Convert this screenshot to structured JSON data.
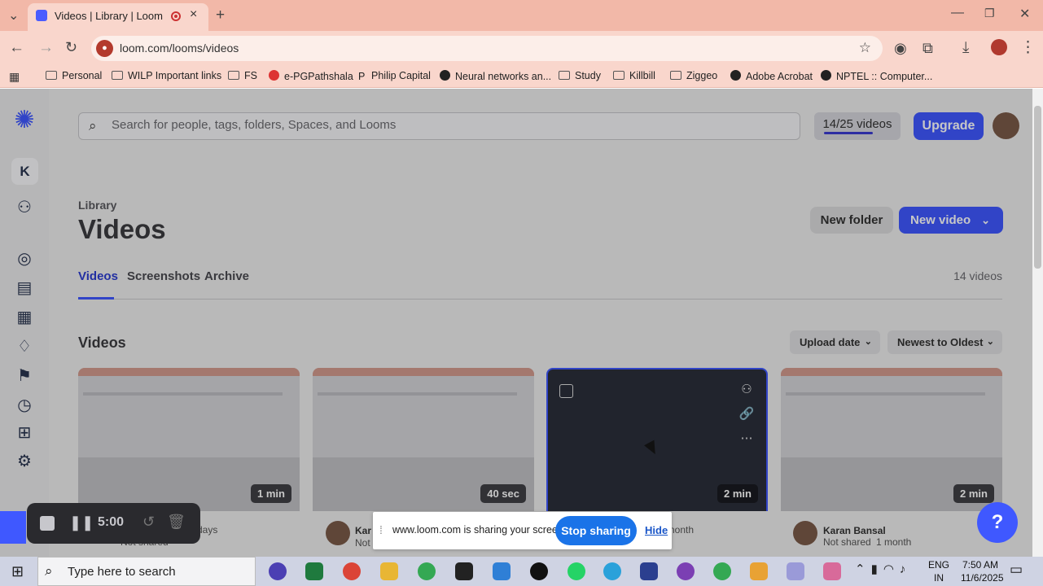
{
  "browser": {
    "tab_title": "Videos | Library | Loom",
    "url": "loom.com/looms/videos",
    "bookmarks": [
      "Personal",
      "WILP Important links",
      "FS",
      "e-PGPathshala",
      "Philip Capital",
      "Neural networks an...",
      "Study",
      "Killbill",
      "Ziggeo",
      "Adobe Acrobat",
      "NPTEL :: Computer..."
    ]
  },
  "header": {
    "search_placeholder": "Search for people, tags, folders, Spaces, and Looms",
    "video_count": "14/25 videos",
    "upgrade_label": "Upgrade"
  },
  "sidebar": {
    "workspace_initial": "K"
  },
  "page": {
    "breadcrumb": "Library",
    "title": "Videos",
    "new_folder_label": "New folder",
    "new_video_label": "New video",
    "tabs": [
      "Videos",
      "Screenshots",
      "Archive"
    ],
    "total_count": "14 videos",
    "section_title": "Videos",
    "sort_field": "Upload date",
    "sort_order": "Newest to Oldest"
  },
  "videos": [
    {
      "duration": "1 min",
      "author": "",
      "shared": "Not shared",
      "age": "days"
    },
    {
      "duration": "40 sec",
      "author": "Kar",
      "shared": "Not"
    },
    {
      "duration": "2 min",
      "age": "nonth"
    },
    {
      "duration": "2 min",
      "author": "Karan Bansal",
      "shared": "Not shared",
      "age": "1 month"
    }
  ],
  "recorder": {
    "time": "5:00"
  },
  "share_notice": {
    "message": "www.loom.com is sharing your screen.",
    "stop_label": "Stop sharing",
    "hide_label": "Hide"
  },
  "taskbar": {
    "search_placeholder": "Type here to search",
    "lang_line1": "ENG",
    "lang_line2": "IN",
    "time": "7:50 AM",
    "date": "11/6/2025"
  },
  "colors": {
    "brand": "#3f58ff",
    "tab_strip": "#f2b8a8"
  }
}
